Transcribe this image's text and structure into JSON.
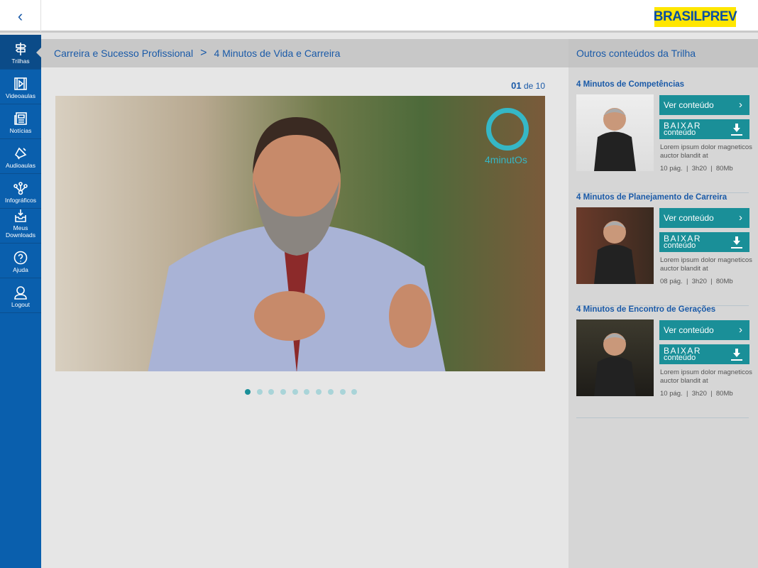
{
  "header": {
    "back_icon": "chevron-left-icon",
    "logo": "BRASILPREV",
    "brand_color": "#ffe600"
  },
  "sidebar": {
    "items": [
      {
        "label": "Trilhas",
        "icon": "signpost-icon",
        "active": true
      },
      {
        "label": "Videoaulas",
        "icon": "video-icon"
      },
      {
        "label": "Notícias",
        "icon": "newspaper-icon"
      },
      {
        "label": "Audioaulas",
        "icon": "speaker-icon"
      },
      {
        "label": "Infográficos",
        "icon": "network-icon"
      },
      {
        "label": "Meus Downloads",
        "icon": "download-tray-icon"
      },
      {
        "label": "Ajuda",
        "icon": "help-icon"
      },
      {
        "label": "Logout",
        "icon": "user-icon"
      }
    ]
  },
  "breadcrumb": {
    "items": [
      "Carreira e Sucesso Profissional",
      "4 Minutos de Vida e Carreira"
    ],
    "separator": ">"
  },
  "pager": {
    "current": "01",
    "of_label": "de 10",
    "total": 10
  },
  "video": {
    "logo_text": "4minutOs"
  },
  "right_panel": {
    "title": "Outros conteúdos da Trilha",
    "cards": [
      {
        "title": "4 Minutos de Competências",
        "view_label": "Ver conteúdo",
        "download_top": "BAIXAR",
        "download_bottom": "conteúdo",
        "desc": "Lorem ipsum dolor magneticos auctor blandit at",
        "meta": "10 pág.  |  3h20  |  80Mb"
      },
      {
        "title": "4 Minutos de Planejamento de Carreira",
        "view_label": "Ver conteúdo",
        "download_top": "BAIXAR",
        "download_bottom": "conteúdo",
        "desc": "Lorem ipsum dolor magneticos auctor blandit at",
        "meta": "08 pág.  |  3h20  |  80Mb"
      },
      {
        "title": "4 Minutos de Encontro de Gerações",
        "view_label": "Ver conteúdo",
        "download_top": "BAIXAR",
        "download_bottom": "conteúdo",
        "desc": "Lorem ipsum dolor magneticos auctor blandit at",
        "meta": "10 pág.  |  3h20  |  80Mb"
      }
    ]
  },
  "colors": {
    "primary": "#0a5fad",
    "accent": "#1a8f98",
    "link": "#1a5aa8"
  }
}
